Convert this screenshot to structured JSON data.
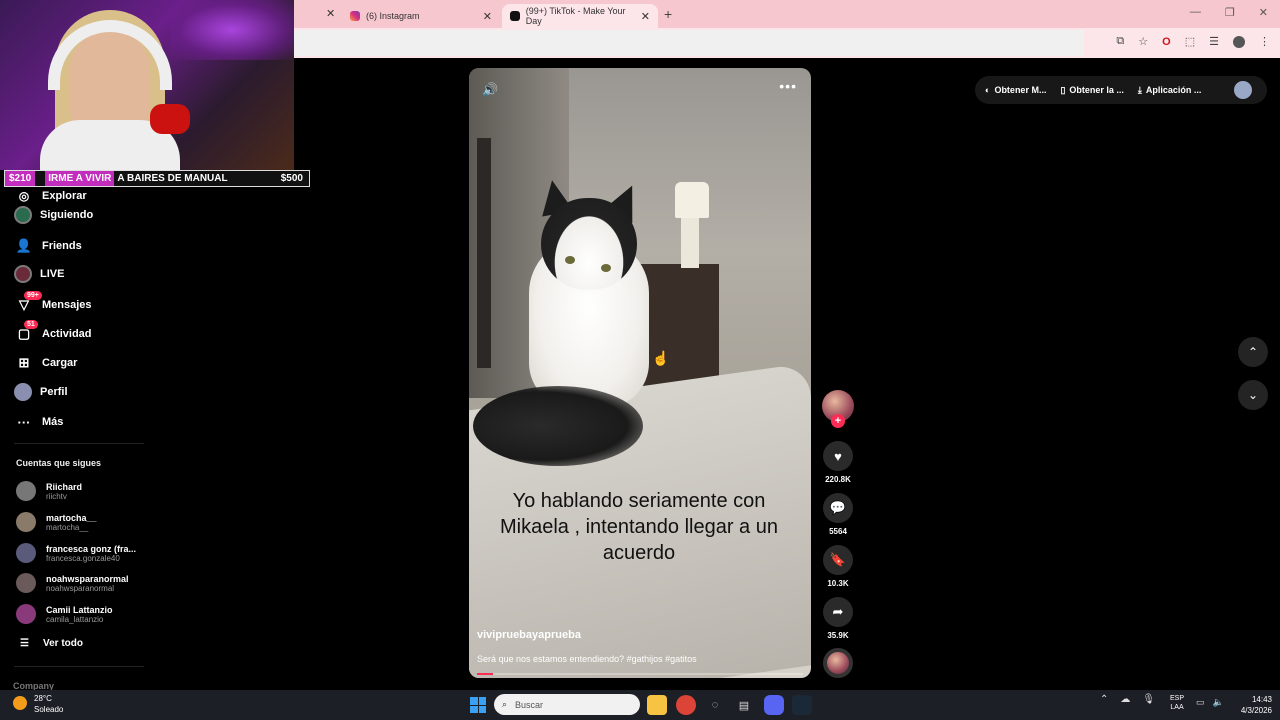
{
  "browser": {
    "tabs": [
      {
        "title": "(6) Instagram"
      },
      {
        "title": "(99+) TikTok - Make Your Day"
      }
    ],
    "new_tab": "+"
  },
  "stream": {
    "donation_left": "$210",
    "donation_msg_highlight": "IRME A VIVIR",
    "donation_msg_rest": "A BAIRES DE MANUAL",
    "donation_goal": "$500"
  },
  "sidebar": {
    "explore_partial": "Explorar",
    "items": [
      {
        "label": "Siguiendo",
        "icon": "following-icon"
      },
      {
        "label": "Friends",
        "icon": "friends-icon"
      },
      {
        "label": "LIVE",
        "icon": "live-icon"
      },
      {
        "label": "Mensajes",
        "icon": "messages-icon",
        "badge": "99+"
      },
      {
        "label": "Actividad",
        "icon": "activity-icon",
        "badge": "51"
      },
      {
        "label": "Cargar",
        "icon": "upload-icon"
      },
      {
        "label": "Perfil",
        "icon": "profile-icon"
      },
      {
        "label": "Más",
        "icon": "more-icon"
      }
    ],
    "following_title": "Cuentas que sigues",
    "following": [
      {
        "name": "Riichard",
        "handle": "riichtv"
      },
      {
        "name": "martocha__",
        "handle": "martocha__"
      },
      {
        "name": "francesca gonz (fra...",
        "handle": "francesca.gonzale40"
      },
      {
        "name": "noahwsparanormal",
        "handle": "noahwsparanormal"
      },
      {
        "name": "Camii Lattanzio",
        "handle": "camila_lattanzio"
      }
    ],
    "see_all": "Ver todo",
    "company": "Company"
  },
  "video": {
    "caption": "Yo hablando seriamente con Mikaela , intentando llegar a un acuerdo",
    "author": "vivipruebayaprueba",
    "description": "Será que nos estamos entendiendo? #gathijos #gatitos",
    "progress": 0.05
  },
  "actions": {
    "likes": "220.8K",
    "comments": "5564",
    "saves": "10.3K",
    "shares": "35.9K",
    "follow_plus": "+"
  },
  "top_bar": {
    "coins": "Obtener M...",
    "app": "Obtener la ...",
    "download": "Aplicación ..."
  },
  "taskbar": {
    "temp": "28°C",
    "weather": "Soleado",
    "search_placeholder": "Buscar",
    "lang1": "ESP",
    "lang2": "LAA",
    "time": "14:43",
    "date": "4/3/2026"
  },
  "colors": {
    "accent": "#fe2c55",
    "tab_bar": "#f6c7cf",
    "donation": "#c22dbd"
  }
}
